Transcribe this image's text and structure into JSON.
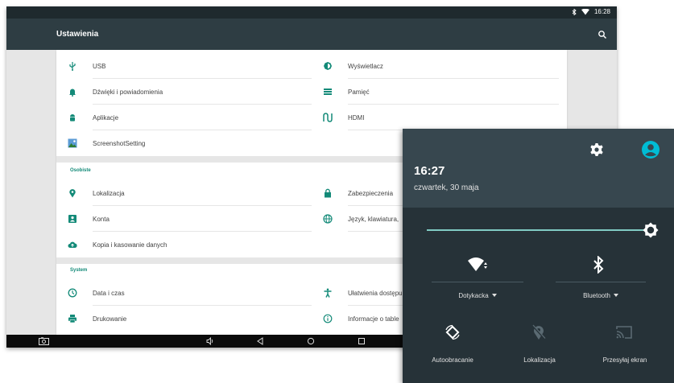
{
  "statusbar": {
    "time": "16:28",
    "bluetooth_icon": "bluetooth-icon",
    "wifi_icon": "wifi-icon"
  },
  "appbar": {
    "title": "Ustawienia",
    "search_icon": "search-icon"
  },
  "sections": {
    "device": {
      "items": [
        {
          "label": "USB",
          "icon": "usb-icon"
        },
        {
          "label": "Wyświetlacz",
          "icon": "brightness-icon"
        },
        {
          "label": "Dźwięki i powiadomienia",
          "icon": "bell-icon"
        },
        {
          "label": "Pamięć",
          "icon": "storage-icon"
        },
        {
          "label": "Aplikacje",
          "icon": "android-icon"
        },
        {
          "label": "HDMI",
          "icon": "hdmi-icon"
        },
        {
          "label": "ScreenshotSetting",
          "icon": "screenshot-icon"
        }
      ]
    },
    "personal": {
      "title": "Osobiste",
      "items": [
        {
          "label": "Lokalizacja",
          "icon": "location-pin-icon"
        },
        {
          "label": "Zabezpieczenia",
          "icon": "lock-icon"
        },
        {
          "label": "Konta",
          "icon": "account-icon"
        },
        {
          "label": "Język, klawiatura,",
          "icon": "globe-icon"
        },
        {
          "label": "Kopia i kasowanie danych",
          "icon": "cloud-upload-icon"
        }
      ]
    },
    "system": {
      "title": "System",
      "items": [
        {
          "label": "Data i czas",
          "icon": "clock-icon"
        },
        {
          "label": "Ułatwienia dostępu",
          "icon": "accessibility-icon"
        },
        {
          "label": "Drukowanie",
          "icon": "printer-icon"
        },
        {
          "label": "Informacje o table",
          "icon": "info-icon"
        }
      ]
    }
  },
  "navbar": {
    "screenshot": "screenshot-icon",
    "volume": "volume-icon",
    "back": "back-icon",
    "home": "home-icon",
    "recents": "recents-icon"
  },
  "shade": {
    "time": "16:27",
    "date": "czwartek, 30 maja",
    "brightness": 0.96,
    "tiles": {
      "wifi": {
        "label": "Dotykacka"
      },
      "bluetooth": {
        "label": "Bluetooth"
      },
      "rotate": {
        "label": "Autoobracanie"
      },
      "location": {
        "label": "Lokalizacja"
      },
      "cast": {
        "label": "Przesyłaj ekran"
      }
    }
  },
  "colors": {
    "appbar": "#2e3d43",
    "accent": "#138a78",
    "shade_bg": "#263238",
    "shade_header": "#37474f",
    "slider": "#80cbc4"
  }
}
